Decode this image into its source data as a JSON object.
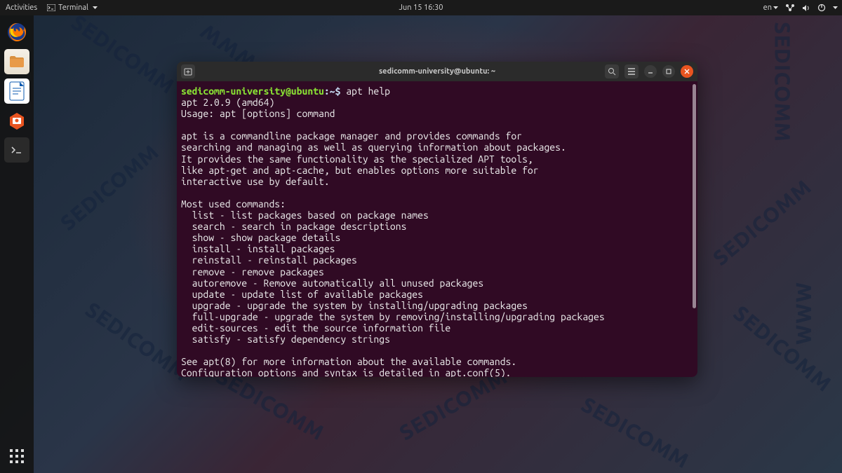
{
  "topbar": {
    "activities": "Activities",
    "terminal_menu": "Terminal",
    "datetime": "Jun 15  16:30",
    "lang": "en"
  },
  "window": {
    "title": "sedicomm-university@ubuntu: ~"
  },
  "terminal": {
    "prompt_user": "sedicomm-university@ubuntu",
    "prompt_path": ":~$ ",
    "command": "apt help",
    "output": "apt 2.0.9 (amd64)\nUsage: apt [options] command\n\napt is a commandline package manager and provides commands for\nsearching and managing as well as querying information about packages.\nIt provides the same functionality as the specialized APT tools,\nlike apt-get and apt-cache, but enables options more suitable for\ninteractive use by default.\n\nMost used commands:\n  list - list packages based on package names\n  search - search in package descriptions\n  show - show package details\n  install - install packages\n  reinstall - reinstall packages\n  remove - remove packages\n  autoremove - Remove automatically all unused packages\n  update - update list of available packages\n  upgrade - upgrade the system by installing/upgrading packages\n  full-upgrade - upgrade the system by removing/installing/upgrading packages\n  edit-sources - edit the source information file\n  satisfy - satisfy dependency strings\n\nSee apt(8) for more information about the available commands.\nConfiguration options and syntax is detailed in apt.conf(5)."
  }
}
